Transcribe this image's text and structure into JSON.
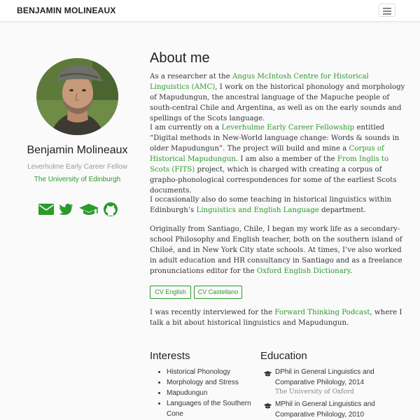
{
  "navbar": {
    "brand": "BENJAMIN MOLINEAUX",
    "menu_icon": "hamburger-menu-icon"
  },
  "profile": {
    "name": "Benjamin Molineaux",
    "role": "Leverhulme Early Career Fellow",
    "organization": "The University of Edinburgh",
    "social_icons": [
      "envelope-icon",
      "twitter-icon",
      "graduation-cap-icon",
      "github-icon"
    ]
  },
  "about": {
    "heading": "About me",
    "p1": {
      "a": "As a researcher at the ",
      "link1": "Angus McIntosh Centre for Historical Linguistics (AMC)",
      "b": ", I work on the historical phonology and morphology of Mapudungun, the ancestral language of the Mapuche people of south-central Chile and Argentina, as well as on the early sounds and spellings of the Scots language."
    },
    "p2": {
      "a": "I am currently on a ",
      "link1": "Leverhulme Early Career Fellowship",
      "b": " entitled “Digital methods in New-World language change: Words & sounds in older Mapudungun”. The project will build and mine a ",
      "link2": "Corpus of Historical Mapudungun",
      "c": ". I am also a member of the ",
      "link3": "From Inglis to Scots (FITS)",
      "d": " project, which is charged with creating a corpus of grapho-phonological correspondences for some of the earliest Scots documents."
    },
    "p3": {
      "a": "I occasionally also do some teaching in historical linguistics within Edinburgh’s ",
      "link1": "Linguistics and English Language",
      "b": " department."
    },
    "p4": {
      "a": "Originally from Santiago, Chile, I began my work life as a secondary-school Philosophy and English teacher, both on the southern island of Chiloé, and in New York City state schools. At times, I’ve also worked in adult education and HR consultancy in Santiago and as a freelance pronunciations editor for the ",
      "link1": "Oxford English Dictionary",
      "b": "."
    },
    "buttons": {
      "cv_english": "CV English",
      "cv_castellano": "CV Castellano"
    },
    "p5": {
      "a": "I was recently interviewed for the ",
      "link1": "Forward Thinking Podcast",
      "b": ", where I talk a bit about historical linguistics and Mapudungun."
    }
  },
  "interests": {
    "heading": "Interests",
    "items": [
      "Historical Phonology",
      "Morphology and Stress",
      "Mapudungun",
      "Languages of the Southern Cone"
    ]
  },
  "education": {
    "heading": "Education",
    "items": [
      {
        "degree": "DPhil in General Linguistics and Comparative Philology, 2014",
        "school": "The University of Oxford"
      },
      {
        "degree": "MPhil in General Linguistics and Comparative Philology, 2010",
        "school": ""
      }
    ]
  },
  "colors": {
    "accent": "#2b9a2b",
    "text": "#333333",
    "muted": "#999999",
    "background": "#fafafa"
  }
}
